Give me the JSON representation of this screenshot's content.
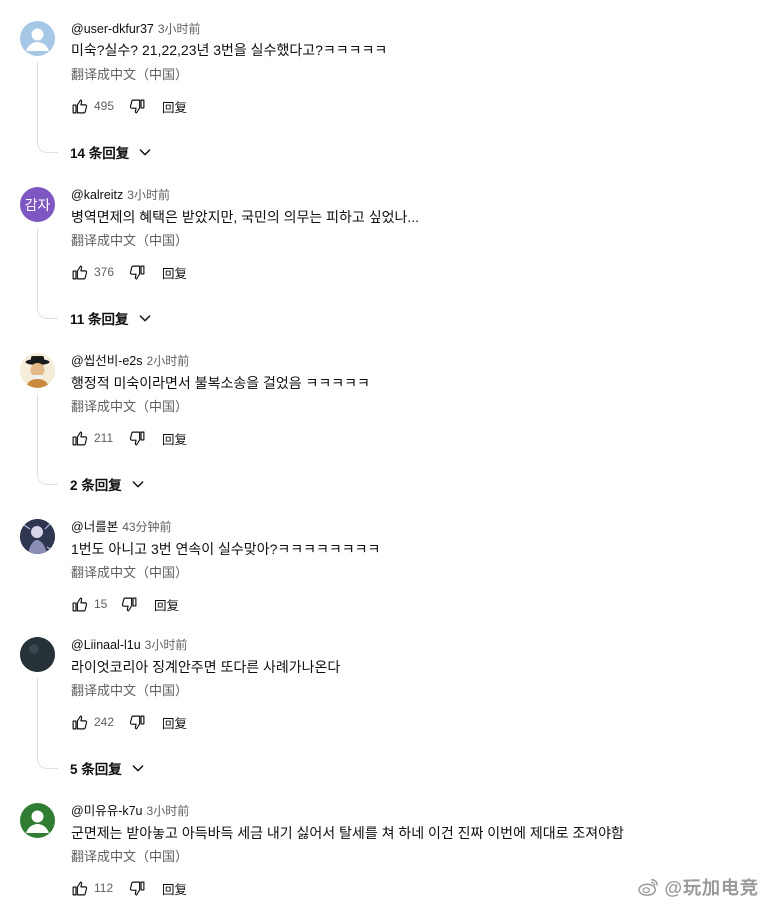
{
  "comments": [
    {
      "handle": "@user-dkfur37",
      "time": "3小时前",
      "text": "미숙?실수? 21,22,23년 3번을 실수했다고?ㅋㅋㅋㅋㅋ",
      "translate": "翻译成中文（中国）",
      "likes": "495",
      "reply_label": "回复",
      "replies": "14 条回复",
      "avatar": {
        "type": "default",
        "color": "#a7c7e7"
      }
    },
    {
      "handle": "@kalreitz",
      "time": "3小时前",
      "text": "병역면제의 혜택은 받았지만, 국민의 의무는 피하고 싶었나...",
      "translate": "翻译成中文（中国）",
      "likes": "376",
      "reply_label": "回复",
      "replies": "11 条回复",
      "avatar": {
        "type": "initials",
        "initials": "감자",
        "color": "#7e57c2"
      }
    },
    {
      "handle": "@씹선비-e2s",
      "time": "2小时前",
      "text": "행정적 미숙이라면서 불복소송을 걸었음 ㅋㅋㅋㅋㅋ",
      "translate": "翻译成中文（中国）",
      "likes": "211",
      "reply_label": "回复",
      "replies": "2 条回复",
      "avatar": {
        "type": "scholar",
        "color": "#c9a472"
      }
    },
    {
      "handle": "@너를본",
      "time": "43分钟前",
      "text": "1번도 아니고 3번 연속이 실수맞아?ㅋㅋㅋㅋㅋㅋㅋㅋ",
      "translate": "翻译成中文（中国）",
      "likes": "15",
      "reply_label": "回复",
      "replies": "",
      "avatar": {
        "type": "art",
        "color": "#3d4a6b"
      }
    },
    {
      "handle": "@Liinaal-l1u",
      "time": "3小时前",
      "text": "라이엇코리아 징계안주면 또다른 사례가나온다",
      "translate": "翻译成中文（中国）",
      "likes": "242",
      "reply_label": "回复",
      "replies": "5 条回复",
      "avatar": {
        "type": "dark",
        "color": "#263238"
      }
    },
    {
      "handle": "@미유유-k7u",
      "time": "3小时前",
      "text": "군면제는 받아놓고 아득바득 세금 내기 싫어서 탈세를 쳐 하네 이건 진짜 이번에 제대로 조져야함",
      "translate": "翻译成中文（中国）",
      "likes": "112",
      "reply_label": "回复",
      "replies": "",
      "avatar": {
        "type": "default",
        "color": "#2e7d32"
      }
    }
  ],
  "watermark": {
    "text": "@玩加电竞",
    "icon": "weibo-icon"
  }
}
